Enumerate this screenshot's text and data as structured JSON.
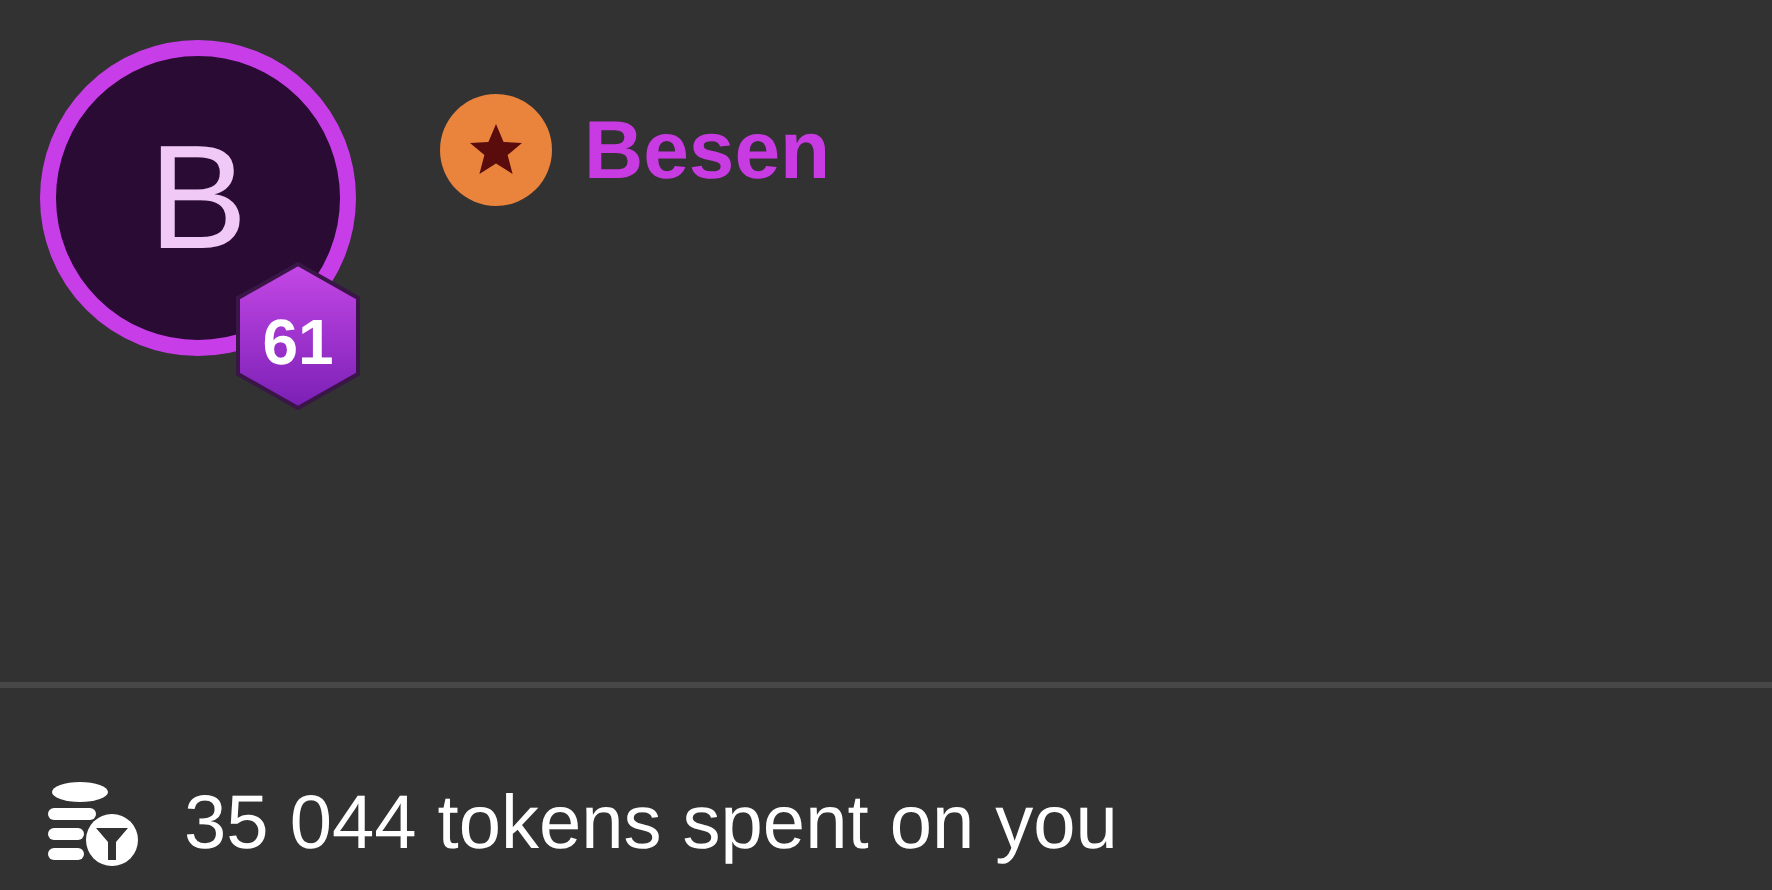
{
  "profile": {
    "initial": "B",
    "level": "61",
    "name": "Besen"
  },
  "stats": {
    "tokens_text": "35 044 tokens spent on you"
  }
}
